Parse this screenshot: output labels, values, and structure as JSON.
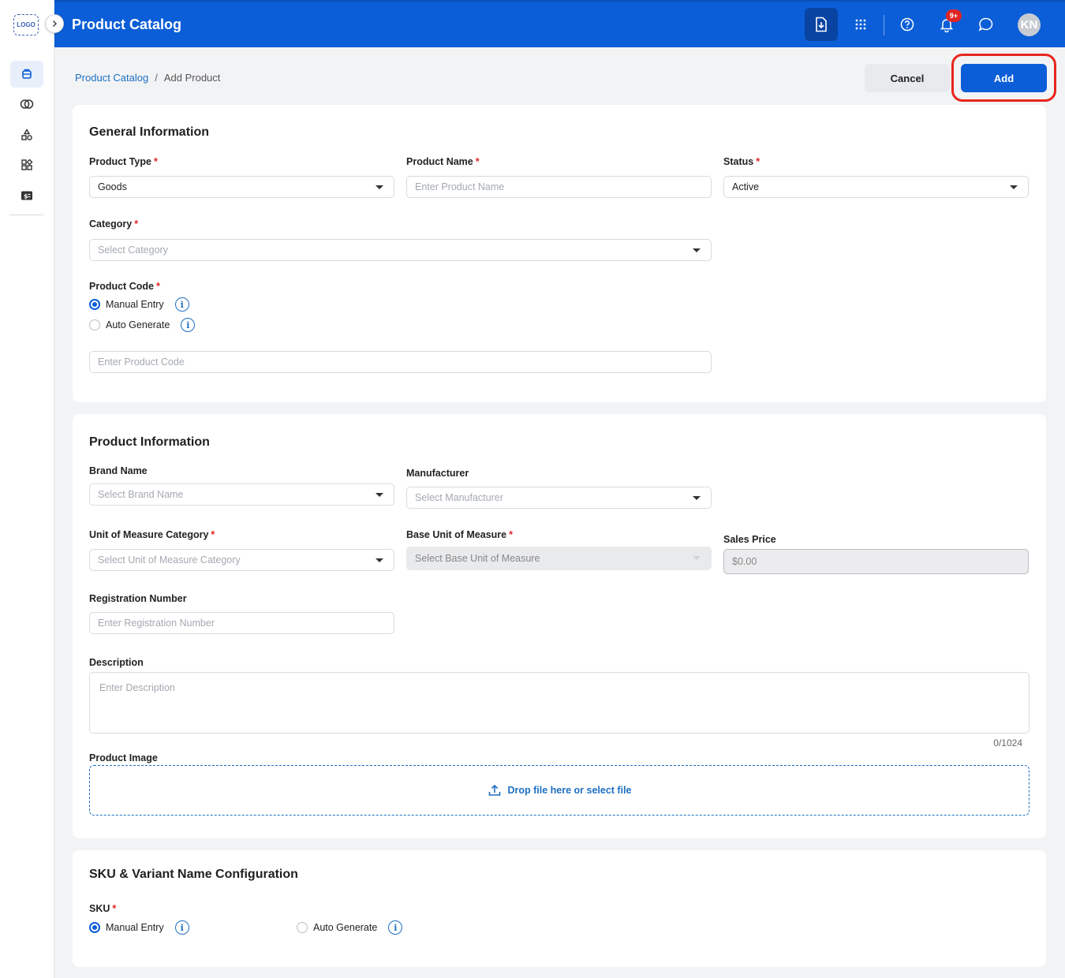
{
  "logo_text": "LOGO",
  "header": {
    "title": "Product Catalog",
    "notification_count": "9+",
    "avatar_initials": "KN"
  },
  "breadcrumb": {
    "root": "Product Catalog",
    "current": "Add Product"
  },
  "actions": {
    "cancel": "Cancel",
    "add": "Add"
  },
  "general": {
    "title": "General Information",
    "product_type": {
      "label": "Product Type",
      "value": "Goods"
    },
    "product_name": {
      "label": "Product Name",
      "placeholder": "Enter Product Name"
    },
    "status": {
      "label": "Status",
      "value": "Active"
    },
    "category": {
      "label": "Category",
      "placeholder": "Select Category"
    },
    "product_code": {
      "label": "Product Code",
      "options": [
        "Manual Entry",
        "Auto Generate"
      ],
      "selected": "Manual Entry",
      "placeholder": "Enter Product Code"
    }
  },
  "product_info": {
    "title": "Product Information",
    "brand": {
      "label": "Brand Name",
      "placeholder": "Select Brand Name"
    },
    "manufacturer": {
      "label": "Manufacturer",
      "placeholder": "Select Manufacturer"
    },
    "uom_category": {
      "label": "Unit of Measure Category",
      "placeholder": "Select Unit of Measure Category"
    },
    "base_uom": {
      "label": "Base Unit of Measure",
      "placeholder": "Select Base Unit of Measure"
    },
    "sales_price": {
      "label": "Sales Price",
      "placeholder": "$0.00"
    },
    "registration": {
      "label": "Registration Number",
      "placeholder": "Enter Registration Number"
    },
    "description": {
      "label": "Description",
      "placeholder": "Enter Description",
      "counter": "0/1024"
    },
    "image": {
      "label": "Product Image",
      "drop_text": "Drop file here or select file"
    }
  },
  "sku": {
    "title": "SKU & Variant Name Configuration",
    "label": "SKU",
    "options": [
      "Manual Entry",
      "Auto Generate"
    ],
    "selected": "Manual Entry"
  },
  "colors": {
    "primary": "#0b5ed7",
    "required": "#e02424",
    "highlight": "#e8261b"
  }
}
